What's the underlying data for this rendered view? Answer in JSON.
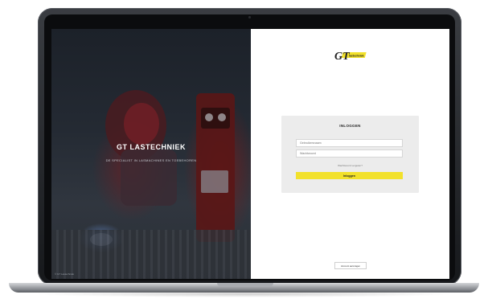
{
  "hero": {
    "title": "GT LASTECHNIEK",
    "subtitle": "DE SPECIALIST IN LASMACHINES EN TOEBEHOREN",
    "footnote": "© GT Lastechniek"
  },
  "brand": {
    "logo_text": "GT",
    "logo_tagline": "lastechniek",
    "accent_color": "#f2e12b"
  },
  "login": {
    "title": "INLOGGEN",
    "username_placeholder": "Gebruikersnaam",
    "password_placeholder": "Wachtwoord",
    "forgot_label": "Wachtwoord vergeten?",
    "submit_label": "Inloggen"
  },
  "footer": {
    "button_label": "Account aanvragen"
  }
}
